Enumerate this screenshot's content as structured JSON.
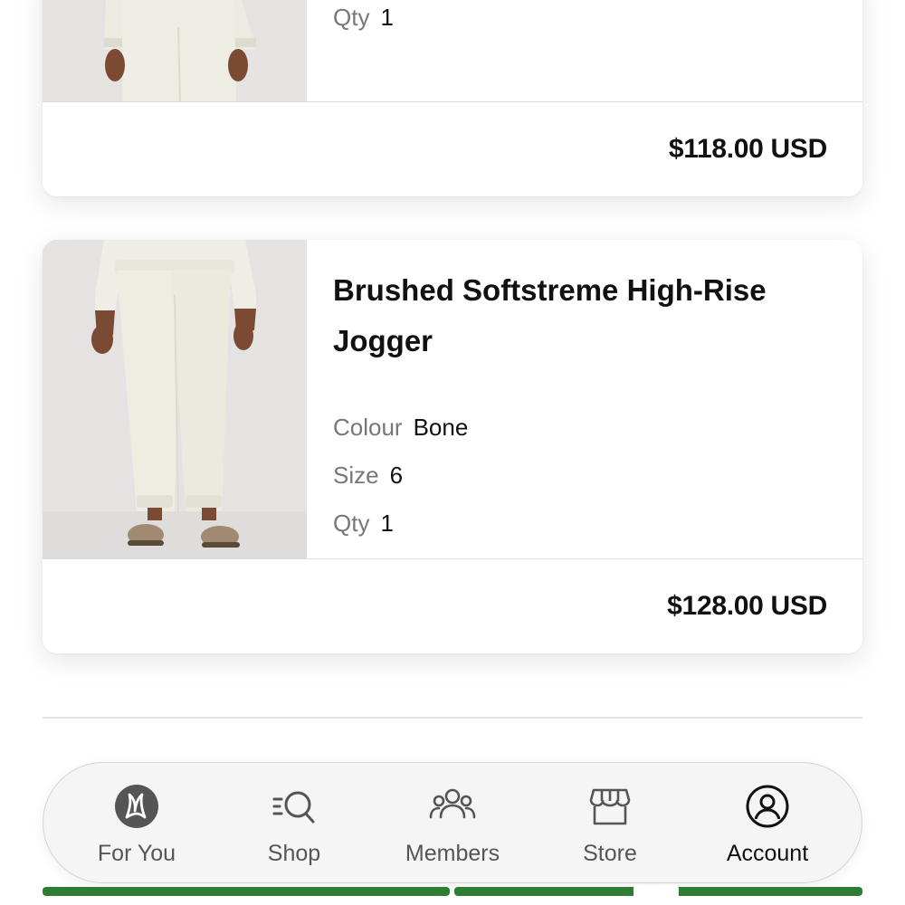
{
  "cart_items": [
    {
      "qty_label": "Qty",
      "qty": "1",
      "price": "$118.00 USD"
    },
    {
      "title": "Brushed Softstreme High-Rise Jogger",
      "colour_label": "Colour",
      "colour": "Bone",
      "size_label": "Size",
      "size": "6",
      "qty_label": "Qty",
      "qty": "1",
      "price": "$128.00 USD"
    }
  ],
  "tab_bar": {
    "items": [
      {
        "label": "For You",
        "icon": "lululemon-logo-icon",
        "active": false
      },
      {
        "label": "Shop",
        "icon": "shop-search-icon",
        "active": false
      },
      {
        "label": "Members",
        "icon": "members-icon",
        "active": false
      },
      {
        "label": "Store",
        "icon": "store-icon",
        "active": false
      },
      {
        "label": "Account",
        "icon": "account-icon",
        "active": true
      }
    ]
  },
  "colors": {
    "text": "#111111",
    "muted": "#777777",
    "accent_strip": "#2e7d32",
    "thumbnail_bg": "#e4e3e2"
  }
}
